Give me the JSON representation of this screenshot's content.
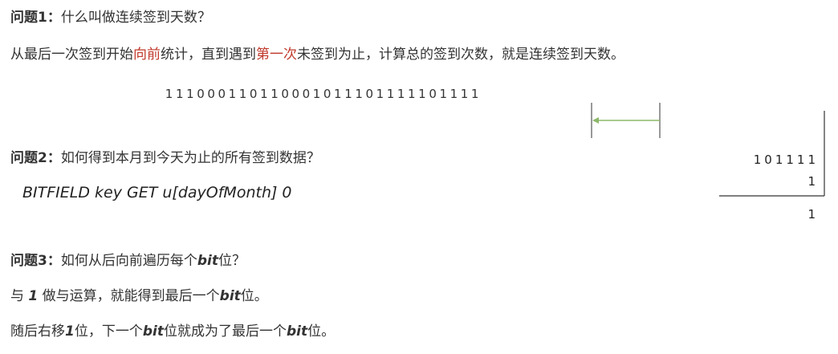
{
  "q1": {
    "label": "问题1：",
    "question": "什么叫做连续签到天数？",
    "ans_a": "从最后一次签到开始",
    "ans_red1": "向前",
    "ans_b": "统计，直到遇到",
    "ans_red2": "第一次",
    "ans_c": "未签到为止，计算总的签到次数，就是连续签到天数。"
  },
  "bit_sequence": [
    "1",
    "1",
    "1",
    "0",
    "0",
    "0",
    "1",
    "1",
    "0",
    "1",
    "1",
    "0",
    "0",
    "0",
    "1",
    "0",
    "1",
    "1",
    "1",
    "0",
    "1",
    "1",
    "1",
    "1",
    "1",
    "0",
    "1",
    "1",
    "1",
    "1"
  ],
  "q2": {
    "label": "问题2：",
    "question": "如何得到本月到今天为止的所有签到数据？",
    "code": "BITFIELD key GET u[dayOfMonth] 0"
  },
  "and_demo": {
    "row1": "101111",
    "row2": "1",
    "result": "1"
  },
  "q3": {
    "label": "问题3：",
    "question_a": "如何从后向前遍历每个",
    "bit_word": "bit",
    "question_b": "位？",
    "line2_a": "与 ",
    "line2_one": "1",
    "line2_b": " 做与运算，就能得到最后一个",
    "line2_c": "位。",
    "line3_a": "随后右移",
    "line3_one": "1",
    "line3_b": "位，下一个",
    "line3_c": "位就成为了最后一个",
    "line3_d": "位。"
  },
  "colors": {
    "text": "#333333",
    "highlight": "#c0392b",
    "arrow": "#8db86b"
  }
}
